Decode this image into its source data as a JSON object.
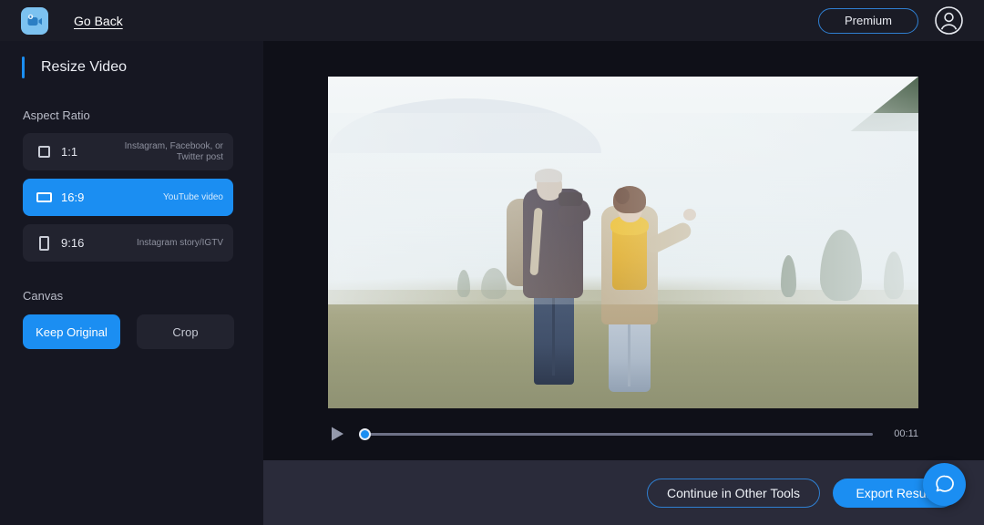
{
  "header": {
    "logo_icon": "video-camera-logo-icon",
    "go_back_label": "Go Back",
    "premium_label": "Premium",
    "avatar_icon": "user-avatar-icon"
  },
  "sidebar": {
    "panel_title": "Resize Video",
    "aspect_ratio": {
      "label": "Aspect Ratio",
      "options": [
        {
          "name": "1:1",
          "description": "Instagram, Facebook, or Twitter post",
          "icon": "square-outline-icon",
          "selected": false
        },
        {
          "name": "16:9",
          "description": "YouTube video",
          "icon": "landscape-rectangle-outline-icon",
          "selected": true
        },
        {
          "name": "9:16",
          "description": "Instagram story/IGTV",
          "icon": "portrait-rectangle-outline-icon",
          "selected": false
        }
      ]
    },
    "canvas": {
      "label": "Canvas",
      "options": [
        {
          "name": "Keep Original",
          "selected": true
        },
        {
          "name": "Crop",
          "selected": false
        }
      ]
    }
  },
  "player": {
    "play_icon": "play-triangle-icon",
    "progress_percent": 0,
    "duration": "00:11"
  },
  "video": {
    "description": "Foggy meadow at dawn with an older couple; man with binoculars and backpack, woman in beige coat with yellow scarf",
    "aspect": "16:9"
  },
  "bottom_bar": {
    "continue_label": "Continue in Other Tools",
    "export_label": "Export Result"
  },
  "chat_widget": {
    "icon": "chat-bubble-icon"
  },
  "colors": {
    "accent_blue": "#1b8ef2",
    "header_bg": "#1a1b25",
    "sidebar_bg": "#161722",
    "main_bg": "#0f1018",
    "bottom_bar_bg": "#2a2b3a",
    "row_bg": "#22232f"
  }
}
